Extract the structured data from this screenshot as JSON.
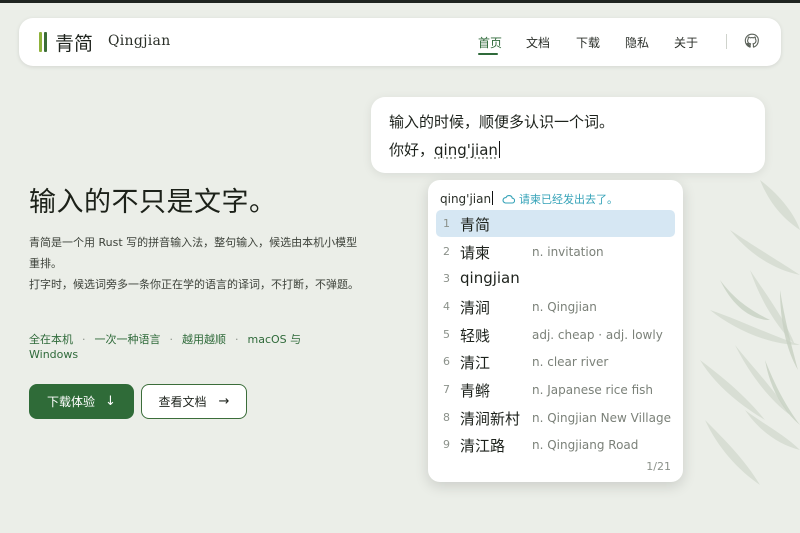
{
  "nav": {
    "brand_cn": "青简",
    "brand_en": "Qingjian",
    "items": [
      {
        "label": "首页",
        "active": true
      },
      {
        "label": "文档",
        "active": false
      },
      {
        "label": "下载",
        "active": false
      },
      {
        "label": "隐私",
        "active": false
      },
      {
        "label": "关于",
        "active": false
      }
    ],
    "github_icon": "github-icon"
  },
  "hero": {
    "title": "输入的不只是文字。",
    "desc_line1": "青简是一个用 Rust 写的拼音输入法，整句输入，候选由本机小模型重排。",
    "desc_line2": "打字时，候选词旁多一条你正在学的语言的译词，不打断，不弹题。",
    "features": [
      "全在本机",
      "一次一种语言",
      "越用越顺",
      "macOS 与 Windows"
    ],
    "btn_primary": "下载体验",
    "btn_secondary": "查看文档"
  },
  "editor": {
    "line1": "输入的时候，顺便多认识一个词。",
    "line2_prefix": "你好，",
    "line2_composing": "qing'jian"
  },
  "candidate_panel": {
    "preedit": "qing'jian",
    "cloud_text": "请柬已经发出去了。",
    "candidates": [
      {
        "num": "1",
        "word": "青简",
        "gloss": "",
        "selected": true
      },
      {
        "num": "2",
        "word": "请柬",
        "gloss": "n. invitation",
        "selected": false
      },
      {
        "num": "3",
        "word": "qingjian",
        "gloss": "",
        "selected": false
      },
      {
        "num": "4",
        "word": "清涧",
        "gloss": "n. Qingjian",
        "selected": false
      },
      {
        "num": "5",
        "word": "轻贱",
        "gloss": "adj. cheap · adj. lowly",
        "selected": false
      },
      {
        "num": "6",
        "word": "清江",
        "gloss": "n. clear river",
        "selected": false
      },
      {
        "num": "7",
        "word": "青鳉",
        "gloss": "n. Japanese rice fish",
        "selected": false
      },
      {
        "num": "8",
        "word": "清涧新村",
        "gloss": "n. Qingjian New Village",
        "selected": false
      },
      {
        "num": "9",
        "word": "清江路",
        "gloss": "n. Qingjiang Road",
        "selected": false
      }
    ],
    "pager": "1/21"
  },
  "colors": {
    "background": "#ebeee8",
    "brand_green": "#2f6b38",
    "selected_candidate": "#d6e7f3",
    "cloud_accent": "#36a3b8"
  }
}
